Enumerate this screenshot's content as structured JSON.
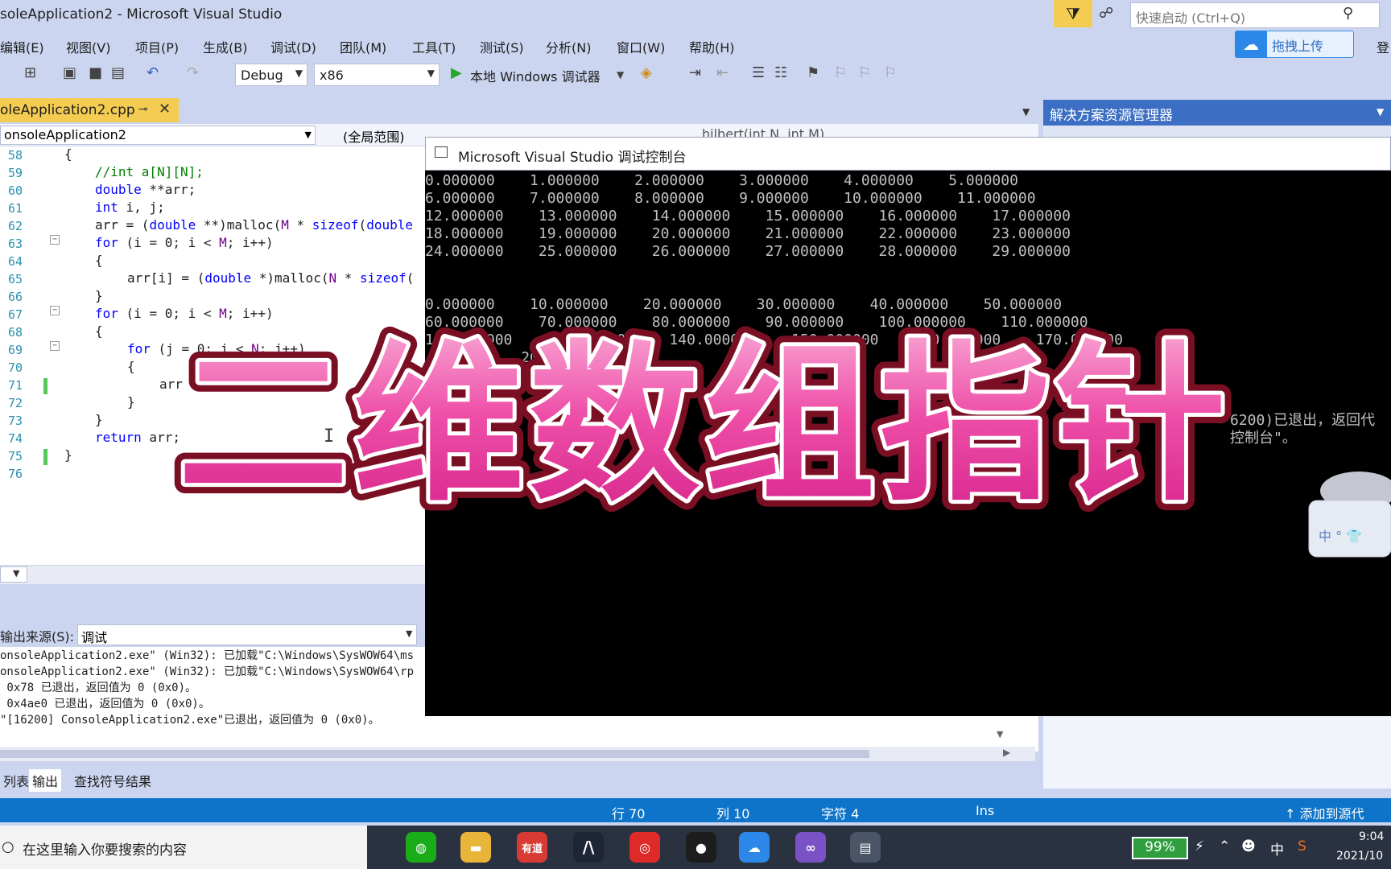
{
  "window": {
    "title": "soleApplication2 - Microsoft Visual Studio",
    "quicklaunch_placeholder": "快速启动 (Ctrl+Q)",
    "signin": "登"
  },
  "menu": [
    "编辑(E)",
    "视图(V)",
    "项目(P)",
    "生成(B)",
    "调试(D)",
    "团队(M)",
    "工具(T)",
    "测试(S)",
    "分析(N)",
    "窗口(W)",
    "帮助(H)"
  ],
  "upload_button": "拖拽上传",
  "toolbar": {
    "config": "Debug",
    "platform": "x86",
    "run_label": "本地 Windows 调试器"
  },
  "doc_tab": {
    "label": "oleApplication2.cpp",
    "pin": "⊸",
    "close": "✕"
  },
  "navbar": {
    "project": "onsoleApplication2",
    "scope": "(全局范围)",
    "function": "hilbert(int N, int M)"
  },
  "editor": {
    "line_numbers": [
      "58",
      "59",
      "60",
      "61",
      "62",
      "63",
      "64",
      "65",
      "66",
      "67",
      "68",
      "69",
      "70",
      "71",
      "72",
      "73",
      "74",
      "75",
      "76"
    ],
    "lines": {
      "l58": "{",
      "l59": "//int a[N][N];",
      "l60_kw": "double",
      "l60_rest": " **arr;",
      "l61_kw": "int",
      "l61_rest": " i, j;",
      "l62_a": "arr = (",
      "l62_kw": "double",
      "l62_b": " **)malloc(",
      "l62_mac": "M",
      "l62_c": " * ",
      "l62_kw2": "sizeof",
      "l62_d": "(",
      "l62_kw3": "double",
      "l63_kw": "for",
      "l63_rest": " (i = 0; i < ",
      "l63_mac": "M",
      "l63_end": "; i++)",
      "l64": "{",
      "l65_a": "arr[i] = (",
      "l65_kw": "double",
      "l65_b": " *)malloc(",
      "l65_mac": "N",
      "l65_c": " * ",
      "l65_kw2": "sizeof",
      "l65_d": "(",
      "l66": "}",
      "l67_kw": "for",
      "l67_rest": " (i = 0; i < ",
      "l67_mac": "M",
      "l67_end": "; i++)",
      "l68": "{",
      "l69_kw": "for",
      "l69_rest": " (j = 0; j < ",
      "l69_mac": "N",
      "l69_end": "; j++)",
      "l70": "{",
      "l71": "arr",
      "l72": "}",
      "l73": "}",
      "l74_kw": "return",
      "l74_rest": " arr;",
      "l75": "}"
    },
    "cursor": "I"
  },
  "output_panel": {
    "source_label": "输出来源(S):",
    "source_value": "调试",
    "lines": [
      "onsoleApplication2.exe\" (Win32): 已加载\"C:\\Windows\\SysWOW64\\ms",
      "onsoleApplication2.exe\" (Win32): 已加载\"C:\\Windows\\SysWOW64\\rp",
      " 0x78 已退出，返回值为 0 (0x0)。",
      " 0x4ae0 已退出，返回值为 0 (0x0)。",
      "\"[16200] ConsoleApplication2.exe\"已退出，返回值为 0 (0x0)。"
    ],
    "tabs": [
      "列表",
      "输出",
      "查找符号结果"
    ]
  },
  "solution_explorer": {
    "title": "解决方案资源管理器"
  },
  "console": {
    "title": "Microsoft Visual Studio 调试控制台",
    "lines": [
      "0.000000    1.000000    2.000000    3.000000    4.000000    5.000000",
      "6.000000    7.000000    8.000000    9.000000    10.000000    11.000000",
      "12.000000    13.000000    14.000000    15.000000    16.000000    17.000000",
      "18.000000    19.000000    20.000000    21.000000    22.000000    23.000000",
      "24.000000    25.000000    26.000000    27.000000    28.000000    29.000000",
      "",
      "",
      "0.000000    10.000000    20.000000    30.000000    40.000000    50.000000",
      "60.000000    70.000000    80.000000    90.000000    100.000000    110.000000",
      "120.000000    130.000000    140.000000    150.000000    160.000000    170.000000",
      "           200.0"
    ],
    "exit_line_1": "6200)已退出，返回代",
    "exit_line_2": "控制台\"。"
  },
  "overlay_caption": "二维数组指针",
  "statusbar": {
    "row": "行 70",
    "col": "列 10",
    "char": "字符 4",
    "ins": "Ins",
    "source_control": "↑ 添加到源代"
  },
  "taskbar": {
    "search_placeholder": "在这里输入你要搜索的内容",
    "app_youdao": "有道",
    "battery": "99%",
    "ime": "中",
    "time": "9:04",
    "date": "2021/10"
  },
  "colors": {
    "vs_chrome": "#ccd5f0",
    "status_blue": "#0e74c9",
    "tab_yellow": "#f5cc52",
    "caption_pink": "#ee4fa8",
    "caption_outline": "#7a0f24"
  }
}
